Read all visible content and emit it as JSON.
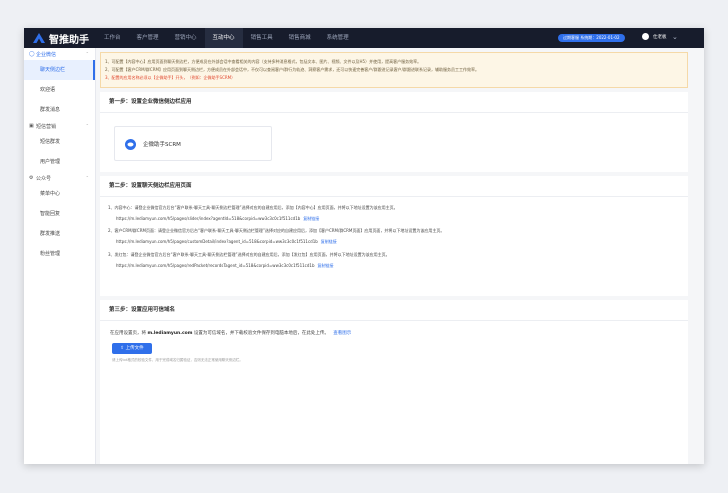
{
  "app": {
    "logo_text": "智推助手"
  },
  "nav": [
    {
      "label": "工作台",
      "active": false
    },
    {
      "label": "客户管理",
      "active": false
    },
    {
      "label": "营销中心",
      "active": false
    },
    {
      "label": "互动中心",
      "active": true
    },
    {
      "label": "销售工具",
      "active": false
    },
    {
      "label": "销售商城",
      "active": false
    },
    {
      "label": "系统管理",
      "active": false
    }
  ],
  "expire_badge": "过期客服 系统期：2022-01-02",
  "user_name": "仕老板",
  "sidebar": {
    "groups": [
      {
        "label": "企业微信",
        "icon": "chat-icon",
        "items": [
          "聊天侧边栏",
          "欢迎语",
          "群发消息"
        ]
      },
      {
        "label": "短信营销",
        "icon": "message-icon",
        "items": [
          "短信群发",
          "用户管理"
        ]
      },
      {
        "label": "公众号",
        "icon": "gear-icon",
        "items": [
          "菜单中心",
          "智能回复",
          "群发推送",
          "粉丝管理"
        ]
      }
    ],
    "active_item": "聊天侧边栏"
  },
  "notice": {
    "line1": "1、可配置【内容中心】应用页面到聊天侧边栏，方便成员在外部会话中查看相关的内容（支持多种消息格式，包括文本、图片、视频、文件以及H5）并使用，提高客户服务效率。",
    "line2": "2、可配置【客户CRM/群CRM】应用页面到聊天侧边栏，方便成员在外部会话中，不仅可以查阅客户/群行为轨迹、洞察客户需求，还可以快速完善客户/群跟进记录客户/群跟进联系记录，辅助服务员工工作效率。",
    "line3": "3、配置的应用名称必须以【企微助手】开头，（例如：企微助手SCRM）"
  },
  "step1": {
    "title": "第一步：设置企业微信侧边栏应用",
    "app_name": "企微助手SCRM"
  },
  "step2": {
    "title": "第二步：设置聊天侧边栏应用页面",
    "items": [
      {
        "text": "1、内容中心：请登企业微信官方后台“客户联系-聊天工具-聊天侧边栏管理”选择对应的自建应用后，添加【内容中心】应用页面，并将以下地址设置为该应用主页。",
        "url": "https://m.lediamyun.com/h5/pages/slider/index?agentId=518&corpid=ww3c3c0c1f511cd1b",
        "link": "复制链接"
      },
      {
        "text": "2、客户CRM/群CRM页面：请登企业微信官方后台“客户联系-聊天工具-聊天侧边栏管理”选择对应的自建应用后，添加【客户CRM/群CRM页面】应用页面，并将以下地址设置为该应用主页。",
        "url": "https://m.lediamyun.com/h5/pages/customDetail/index?agent_id=518&corpid=ww3c3c0c1f511cd1b",
        "link": "复制链接"
      },
      {
        "text": "3、发红包：请登企业微信官方后台“客户联系-聊天工具-聊天侧边栏管理”选择对应的自建应用后，添加【发红包】应用页面，并将以下地址设置为该应用主页。",
        "url": "https://m.lediamyun.com/h5/pages/redPacket/recordsTagent_id=518&corpid=ww3c3c0c1f511cd1b",
        "link": "复制链接"
      }
    ]
  },
  "step3": {
    "title": "第三步：设置应用可信域名",
    "desc_prefix": "在应用设置页，将",
    "domain": "m.lediamyun.com",
    "desc_suffix": "设置为可信域名，并下载校验文件保存到电脑本地后，在此处上传。",
    "view_link": "查看图示",
    "upload_label": "上传文件",
    "tip": "请上传txt格式的校验文件，用于完成域名归属验证，否则无法正常使用聊天侧边栏。"
  }
}
